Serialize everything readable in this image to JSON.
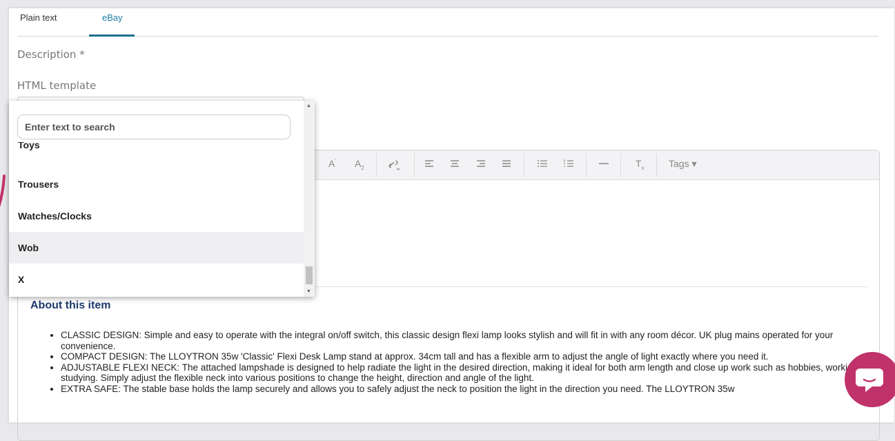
{
  "tabs": [
    {
      "label": "Plain text",
      "active": false
    },
    {
      "label": "eBay",
      "active": true
    }
  ],
  "form": {
    "description_label": "Description *",
    "template_label": "HTML template"
  },
  "dropdown": {
    "search_placeholder": "Enter text to search",
    "partial_item": "Toys",
    "items": [
      "Trousers",
      "Watches/Clocks",
      "Wob",
      "X"
    ],
    "highlighted": "Wob"
  },
  "toolbar": {
    "buttons": [
      "superscript-icon",
      "subscript-icon",
      "link-icon",
      "align-left-icon",
      "align-center-icon",
      "align-right-icon",
      "align-justify-icon",
      "bullet-list-icon",
      "numbered-list-icon",
      "horizontal-rule-icon",
      "clear-format-icon"
    ],
    "tags_label": "Tags"
  },
  "content": {
    "heading": "About this item",
    "bullets": [
      "CLASSIC DESIGN: Simple and easy to operate with the integral on/off switch, this classic design flexi lamp looks stylish and will fit in with any room décor. UK plug mains operated for your convenience.",
      "COMPACT DESIGN: The LLOYTRON 35w 'Classic' Flexi Desk Lamp stand at approx. 34cm tall and has a flexible arm to adjust the angle of light exactly where you need it.",
      "ADJUSTABLE FLEXI NECK: The attached lampshade is designed to help radiate the light in the desired direction, making it ideal for both arm length and close up work such as hobbies, working or studying. Simply adjust the flexible neck into various positions to change the height, direction and angle of the light.",
      "EXTRA SAFE: The stable base holds the lamp securely and allows you to safely adjust the neck to position the light in the direction you need. The LLOYTRON 35w"
    ]
  },
  "colors": {
    "active_tab": "#1a7fa0",
    "heading": "#1d3a6e",
    "chat_button": "#c0326a"
  }
}
